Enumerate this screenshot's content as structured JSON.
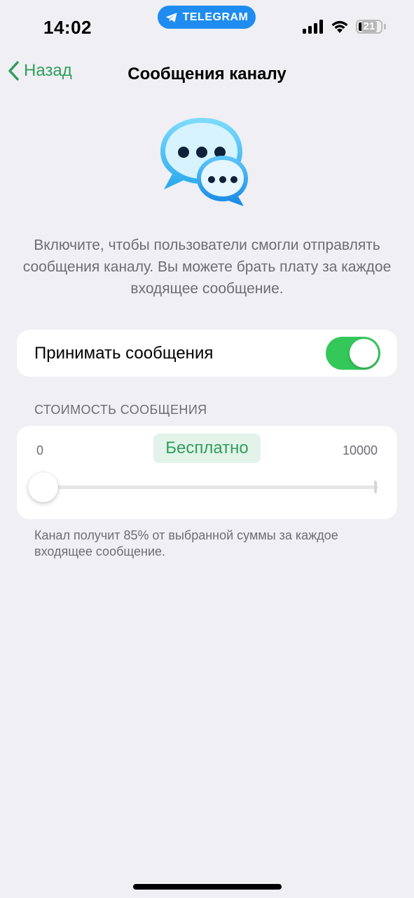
{
  "status_bar": {
    "time": "14:02",
    "app_pill": "TELEGRAM",
    "battery": "21",
    "icons": [
      "cellular-signal-icon",
      "wifi-icon",
      "battery-icon"
    ]
  },
  "nav": {
    "back_label": "Назад",
    "title": "Сообщения каналу"
  },
  "hero": {
    "icon": "chat-bubbles-icon"
  },
  "description": "Включите, чтобы пользователи смогли отправлять сообщения каналу. Вы можете брать плату за каждое входящее сообщение.",
  "accept_messages": {
    "label": "Принимать сообщения",
    "enabled": true
  },
  "price_section": {
    "header": "СТОИМОСТЬ СООБЩЕНИЯ",
    "min_label": "0",
    "max_label": "10000",
    "current_value_label": "Бесплатно",
    "slider_value": 0
  },
  "footer_note": "Канал получит 85% от выбранной суммы за каждое входящее сообщение.",
  "colors": {
    "accent": "#2f9e5c",
    "switch_on": "#34c759",
    "app_pill": "#1e8cf0",
    "background": "#efeff4"
  }
}
